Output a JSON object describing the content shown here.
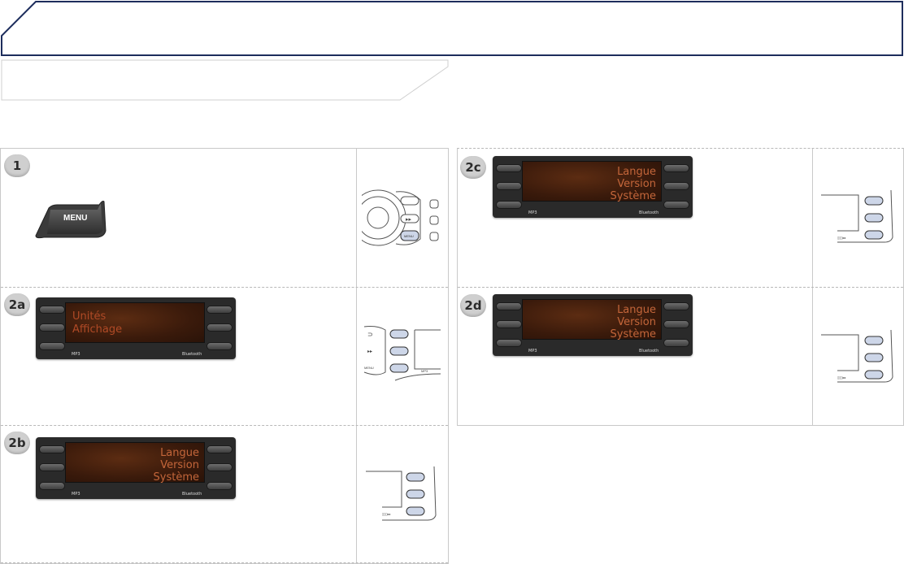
{
  "menu_button": {
    "label": "MENU"
  },
  "steps": [
    {
      "badge": "1"
    },
    {
      "badge": "2a",
      "lines": [
        "Unités",
        "Affichage"
      ]
    },
    {
      "badge": "2b",
      "lines": [
        "Langue",
        "Version",
        "Système"
      ]
    },
    {
      "badge": "2c",
      "lines": [
        "Langue",
        "Version",
        "Système"
      ]
    },
    {
      "badge": "2d",
      "lines": [
        "Langue",
        "Version",
        "Système"
      ]
    }
  ],
  "radio_footer": {
    "left": "MP3",
    "right": "Bluetooth"
  },
  "side_sketch": {
    "menu": "MENU",
    "mp3": "MP3"
  },
  "colors": {
    "header_border": "#1d2d5c",
    "screen_text": "#c4663a",
    "panel_border": "#c9c9c9"
  }
}
